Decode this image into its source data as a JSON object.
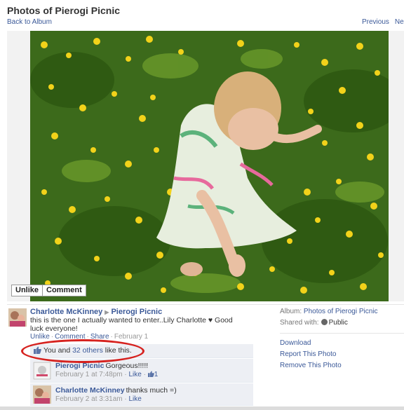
{
  "header": {
    "title": "Photos of Pierogi Picnic",
    "back_link": "Back to Album",
    "previous": "Previous",
    "next": "Next"
  },
  "photo_actions": {
    "unlike": "Unlike",
    "comment": "Comment"
  },
  "post": {
    "author": "Charlotte McKinney",
    "target": "Pierogi Picnic",
    "caption": "this is the one I actually wanted to enter..Lily Charlotte ♥ Good luck everyone!",
    "meta": {
      "unlike": "Unlike",
      "comment": "Comment",
      "share": "Share",
      "date": "February 1"
    }
  },
  "likes": {
    "you_and": "You and",
    "others": "32 others",
    "like_this": "like this."
  },
  "comments": [
    {
      "author": "Pierogi Picnic",
      "text": "Gorgeous!!!!!",
      "time": "February 1 at 7:48pm",
      "like": "Like",
      "like_count": "1"
    },
    {
      "author": "Charlotte McKinney",
      "text": "thanks much =)",
      "time": "February 2 at 3:31am",
      "like": "Like"
    }
  ],
  "sidebar": {
    "album_label": "Album:",
    "album_name": "Photos of Pierogi Picnic",
    "shared_with_label": "Shared with:",
    "privacy": "Public",
    "actions": [
      "Download",
      "Report This Photo",
      "Remove This Photo"
    ]
  },
  "colors": {
    "link": "#3b5998",
    "highlight_ring": "#d6221f",
    "comment_bg": "#edeff4"
  }
}
